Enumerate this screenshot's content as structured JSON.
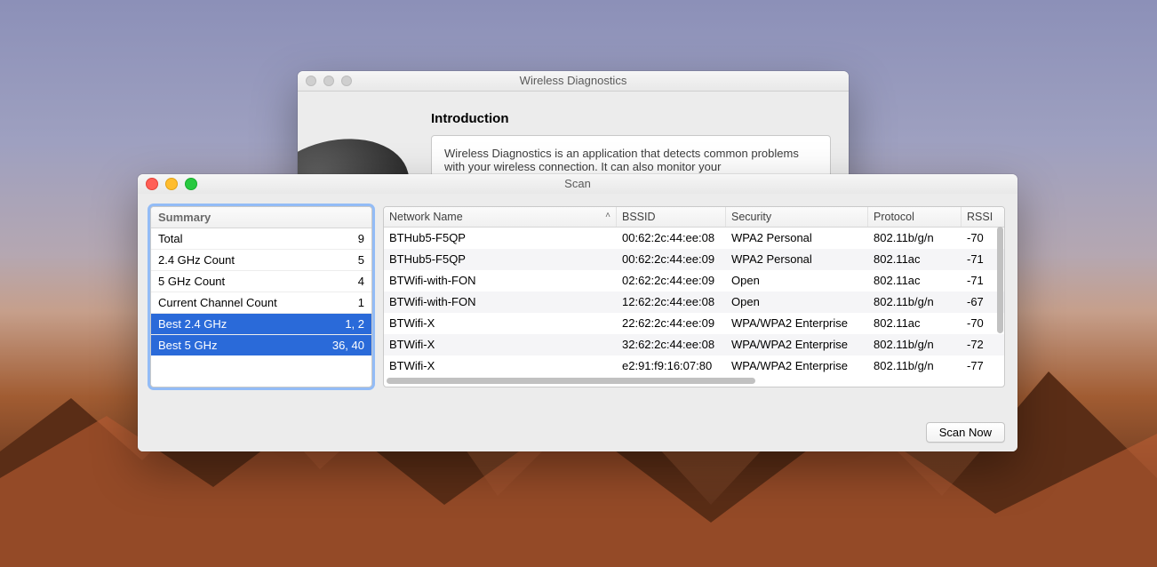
{
  "back_window": {
    "title": "Wireless Diagnostics",
    "heading": "Introduction",
    "body_text": "Wireless Diagnostics is an application that detects common problems with your wireless connection. It can also monitor your"
  },
  "scan_window": {
    "title": "Scan",
    "summary_header": "Summary",
    "summary": [
      {
        "label": "Total",
        "value": "9",
        "selected": false
      },
      {
        "label": "2.4 GHz Count",
        "value": "5",
        "selected": false
      },
      {
        "label": "5 GHz Count",
        "value": "4",
        "selected": false
      },
      {
        "label": "Current Channel Count",
        "value": "1",
        "selected": false
      },
      {
        "label": "Best 2.4 GHz",
        "value": "1, 2",
        "selected": true
      },
      {
        "label": "Best 5 GHz",
        "value": "36, 40",
        "selected": true
      }
    ],
    "columns": {
      "name": "Network Name",
      "bssid": "BSSID",
      "security": "Security",
      "protocol": "Protocol",
      "rssi": "RSSI"
    },
    "sort_column": "name",
    "sort_dir": "asc",
    "rows": [
      {
        "name": "BTHub5-F5QP",
        "bssid": "00:62:2c:44:ee:08",
        "security": "WPA2 Personal",
        "protocol": "802.11b/g/n",
        "rssi": "-70"
      },
      {
        "name": "BTHub5-F5QP",
        "bssid": "00:62:2c:44:ee:09",
        "security": "WPA2 Personal",
        "protocol": "802.11ac",
        "rssi": "-71"
      },
      {
        "name": "BTWifi-with-FON",
        "bssid": "02:62:2c:44:ee:09",
        "security": "Open",
        "protocol": "802.11ac",
        "rssi": "-71"
      },
      {
        "name": "BTWifi-with-FON",
        "bssid": "12:62:2c:44:ee:08",
        "security": "Open",
        "protocol": "802.11b/g/n",
        "rssi": "-67"
      },
      {
        "name": "BTWifi-X",
        "bssid": "22:62:2c:44:ee:09",
        "security": "WPA/WPA2 Enterprise",
        "protocol": "802.11ac",
        "rssi": "-70"
      },
      {
        "name": "BTWifi-X",
        "bssid": "32:62:2c:44:ee:08",
        "security": "WPA/WPA2 Enterprise",
        "protocol": "802.11b/g/n",
        "rssi": "-72"
      },
      {
        "name": "BTWifi-X",
        "bssid": "e2:91:f9:16:07:80",
        "security": "WPA/WPA2 Enterprise",
        "protocol": "802.11b/g/n",
        "rssi": "-77"
      }
    ],
    "scan_button": "Scan Now"
  }
}
